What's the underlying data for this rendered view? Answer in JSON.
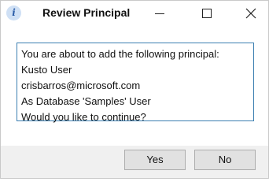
{
  "window": {
    "title": "Review Principal",
    "icon": "info-icon",
    "icon_glyph": "i",
    "controls": [
      "minimize-icon",
      "maximize-icon",
      "close-icon"
    ]
  },
  "message": {
    "lines": [
      "You are about to add the following principal:",
      "Kusto User",
      "crisbarros@microsoft.com",
      "As Database 'Samples' User",
      "Would you like to continue?"
    ]
  },
  "buttons": {
    "yes_label": "Yes",
    "no_label": "No"
  },
  "colors": {
    "border_accent": "#3c7fb1",
    "button_face": "#e1e1e1",
    "footer_background": "#f0f0f0"
  }
}
